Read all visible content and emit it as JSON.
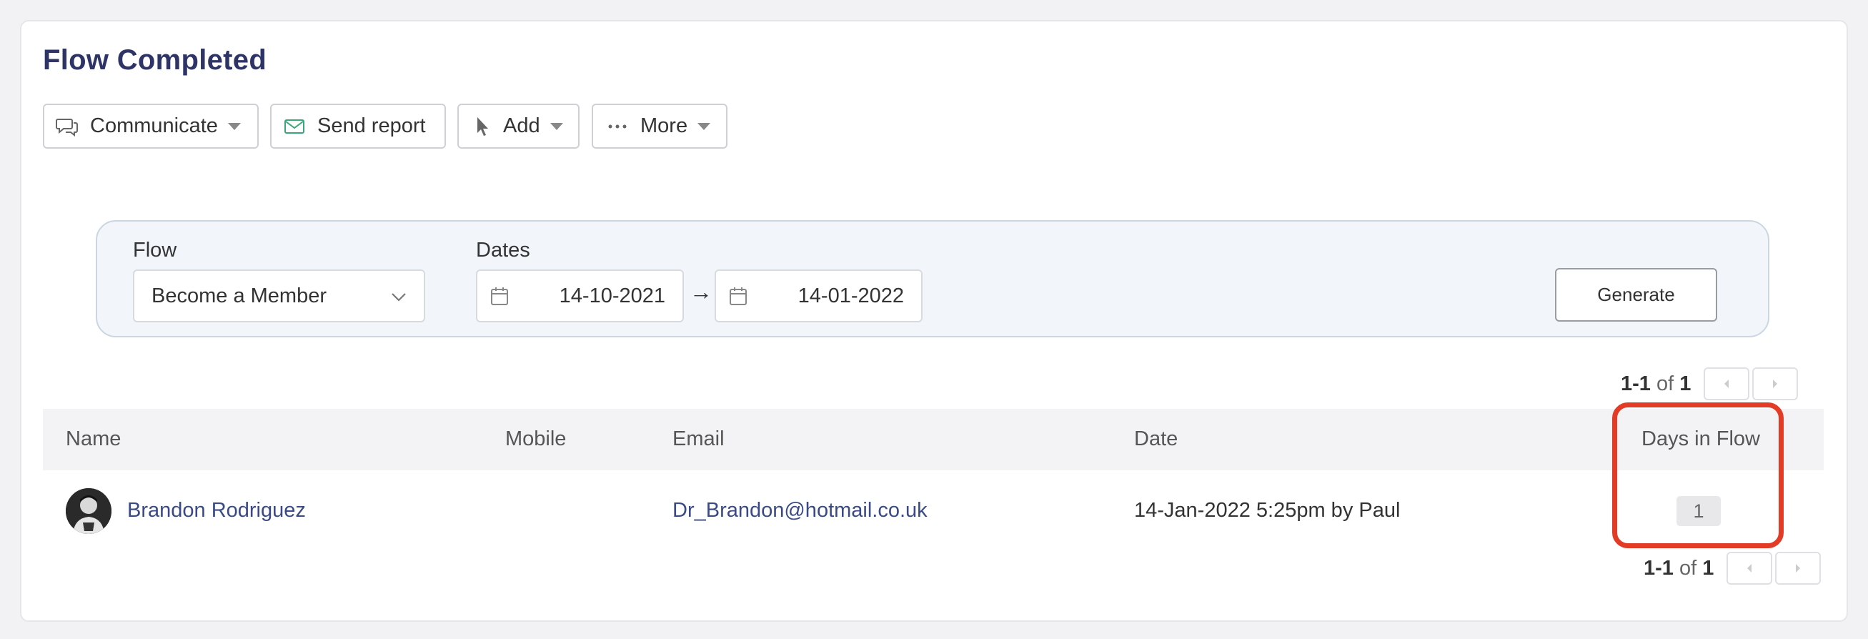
{
  "page": {
    "title": "Flow Completed"
  },
  "toolbar": {
    "communicate_label": "Communicate",
    "send_report_label": "Send report",
    "add_label": "Add",
    "more_label": "More"
  },
  "filters": {
    "flow_label": "Flow",
    "flow_value": "Become a Member",
    "dates_label": "Dates",
    "date_from": "14-10-2021",
    "date_arrow": "→",
    "date_to": "14-01-2022",
    "generate_label": "Generate"
  },
  "pagination": {
    "range": "1-1",
    "of": "of",
    "total": "1"
  },
  "table": {
    "headers": [
      "Name",
      "Mobile",
      "Email",
      "Date",
      "Days in Flow"
    ],
    "rows": [
      {
        "name": "Brandon Rodriguez",
        "mobile": "",
        "email": "Dr_Brandon@hotmail.co.uk",
        "date": "14-Jan-2022 5:25pm by Paul",
        "days_in_flow": "1"
      }
    ]
  },
  "colors": {
    "title": "#2e3566",
    "link": "#3a4a86",
    "highlight": "#e23c26",
    "panel_bg": "#f2f6fa",
    "mail_icon": "#3aa67a"
  },
  "icons": [
    "chat-icon",
    "mail-icon",
    "cursor-icon",
    "ellipsis-icon",
    "chevron-down-icon",
    "calendar-icon",
    "prev-page-icon",
    "next-page-icon"
  ]
}
